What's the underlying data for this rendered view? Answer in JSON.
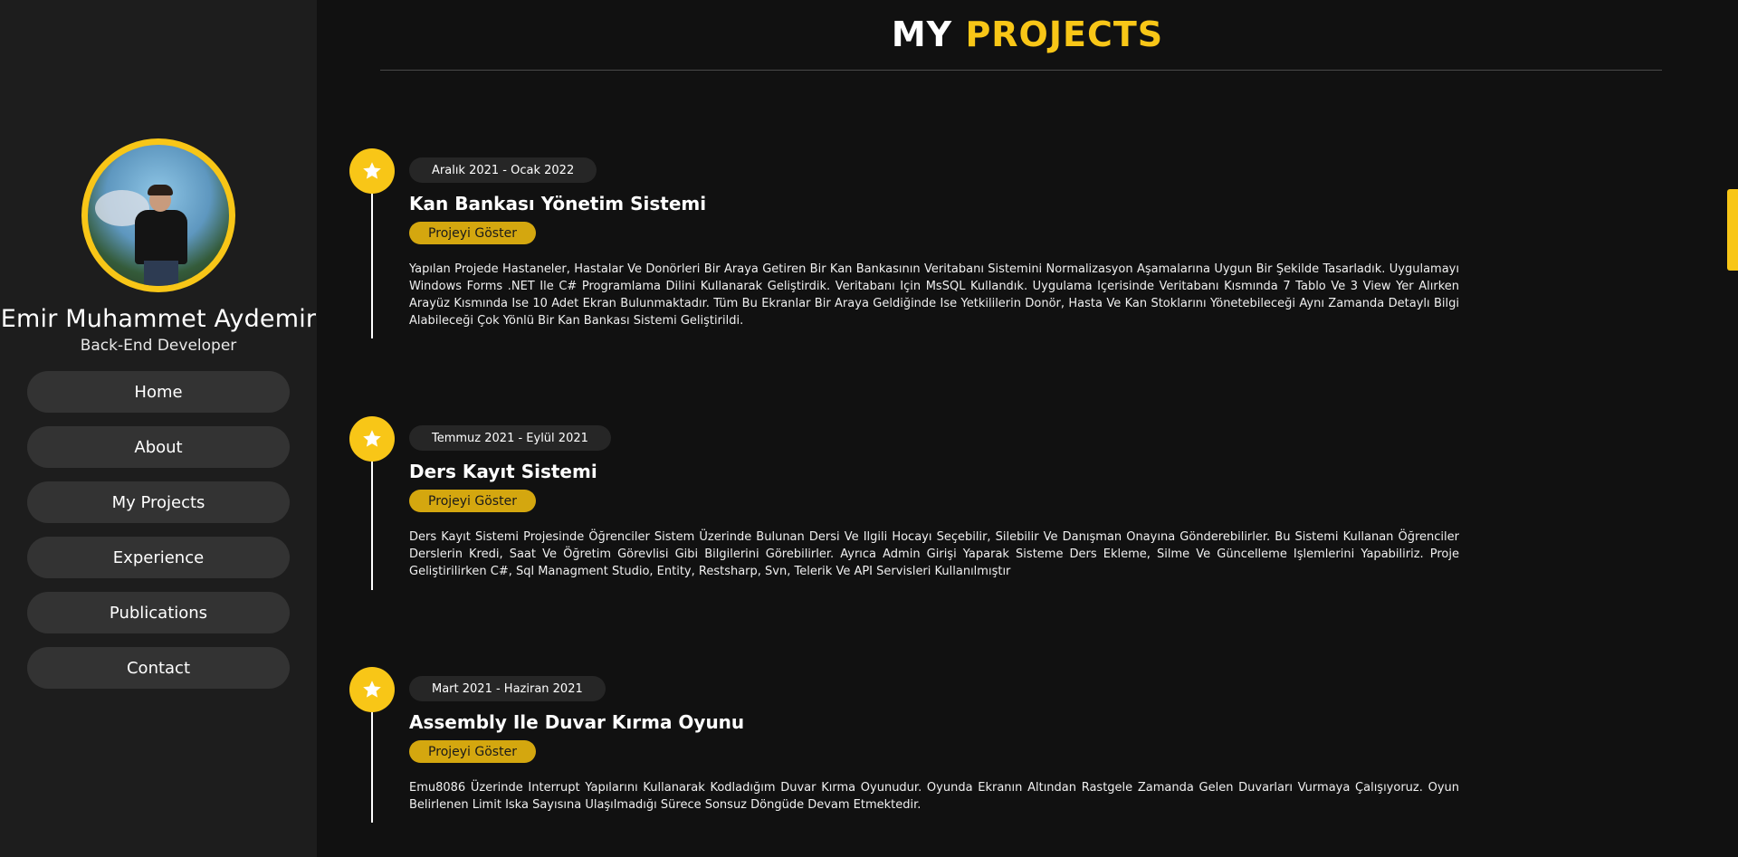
{
  "profile": {
    "name": "Emir Muhammet Aydemir",
    "role": "Back-End Developer"
  },
  "nav": [
    "Home",
    "About",
    "My Projects",
    "Experience",
    "Publications",
    "Contact"
  ],
  "page": {
    "title_part1": "MY",
    "title_part2": "PROJECTS"
  },
  "colors": {
    "accent": "#f8c617",
    "button": "#d4a70f",
    "sidebar": "#1d1d1d",
    "background": "#111111"
  },
  "projects": [
    {
      "date": "Aralık 2021 - Ocak 2022",
      "title": "Kan Bankası Yönetim Sistemi",
      "button": "Projeyi Göster",
      "icon": "star-icon",
      "description": "Yapılan Projede Hastaneler, Hastalar Ve Donörleri Bir Araya Getiren Bir Kan Bankasının Veritabanı Sistemini Normalizasyon Aşamalarına Uygun Bir Şekilde Tasarladık. Uygulamayı Windows Forms .NET Ile C# Programlama Dilini Kullanarak Geliştirdik. Veritabanı Için MsSQL Kullandık. Uygulama Içerisinde Veritabanı Kısmında 7 Tablo Ve 3 View Yer Alırken Arayüz Kısmında Ise 10 Adet Ekran Bulunmaktadır. Tüm Bu Ekranlar Bir Araya Geldiğinde Ise Yetkililerin Donör, Hasta Ve Kan Stoklarını Yönetebileceği Aynı Zamanda Detaylı Bilgi Alabileceği Çok Yönlü Bir Kan Bankası Sistemi Geliştirildi."
    },
    {
      "date": "Temmuz 2021 - Eylül 2021",
      "title": "Ders Kayıt Sistemi",
      "button": "Projeyi Göster",
      "icon": "star-icon",
      "description": "Ders Kayıt Sistemi Projesinde Öğrenciler Sistem Üzerinde Bulunan Dersi Ve Ilgili Hocayı Seçebilir, Silebilir Ve Danışman Onayına Gönderebilirler. Bu Sistemi Kullanan Öğrenciler Derslerin Kredi, Saat Ve Öğretim Görevlisi Gibi Bilgilerini Görebilirler. Ayrıca Admin Girişi Yaparak Sisteme Ders Ekleme, Silme Ve Güncelleme Işlemlerini Yapabiliriz. Proje Geliştirilirken C#, Sql Managment Studio, Entity, Restsharp, Svn, Telerik Ve API Servisleri Kullanılmıştır"
    },
    {
      "date": "Mart 2021 - Haziran 2021",
      "title": "Assembly Ile Duvar Kırma Oyunu",
      "button": "Projeyi Göster",
      "icon": "star-icon",
      "description": "Emu8086 Üzerinde Interrupt Yapılarını Kullanarak Kodladığım Duvar Kırma Oyunudur. Oyunda Ekranın Altından Rastgele Zamanda Gelen Duvarları Vurmaya Çalışıyoruz. Oyun Belirlenen Limit Iska Sayısına Ulaşılmadığı Sürece Sonsuz Döngüde Devam Etmektedir."
    }
  ]
}
